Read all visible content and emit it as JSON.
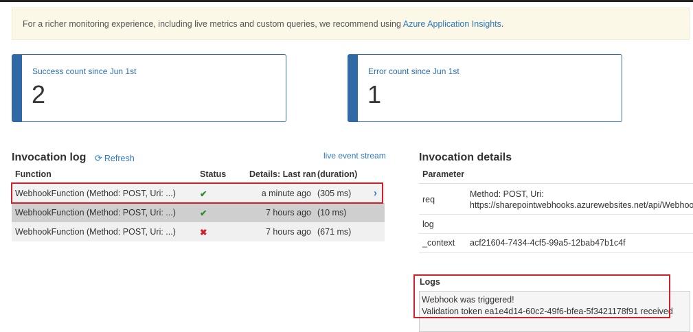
{
  "banner": {
    "text": "For a richer monitoring experience, including live metrics and custom queries, we recommend using ",
    "link": "Azure Application Insights",
    "suffix": "."
  },
  "cards": {
    "success": {
      "label": "Success count since Jun 1st",
      "value": "2"
    },
    "error": {
      "label": "Error count since Jun 1st",
      "value": "1"
    }
  },
  "invocation_log": {
    "title": "Invocation log",
    "refresh_label": "Refresh",
    "refresh_icon": "refresh-icon",
    "live_link": "live event stream",
    "columns": {
      "function": "Function",
      "status": "Status",
      "details": "Details: Last ran",
      "duration": "(duration)"
    },
    "rows": [
      {
        "function": "WebhookFunction (Method: POST, Uri: ...)",
        "status_icon": "✔",
        "when": "a minute ago",
        "duration": "(305 ms)"
      },
      {
        "function": "WebhookFunction (Method: POST, Uri: ...)",
        "status_icon": "✔",
        "when": "7 hours ago",
        "duration": "(10 ms)"
      },
      {
        "function": "WebhookFunction (Method: POST, Uri: ...)",
        "status_icon": "✖",
        "when": "7 hours ago",
        "duration": "(671 ms)"
      }
    ],
    "selected_chevron": "›"
  },
  "details": {
    "title": "Invocation details",
    "column": "Parameter",
    "params": [
      {
        "key": "req",
        "value_line1": "Method: POST, Uri:",
        "value_line2": "https://sharepointwebhooks.azurewebsites.net/api/WebhookF"
      },
      {
        "key": "log",
        "value_line1": ""
      },
      {
        "key": "_context",
        "value_line1": "acf21604-7434-4cf5-99a5-12bab47b1c4f"
      }
    ]
  },
  "logs": {
    "label": "Logs",
    "lines": [
      "Webhook was triggered!",
      "Validation token ea1e4d14-60c2-49f6-bfea-5f3421178f91 received"
    ]
  },
  "colors": {
    "accent": "#2f6aa6",
    "link": "#2a79c0",
    "success": "#2e8b2e",
    "error": "#d0202a",
    "highlight": "#d0202a"
  }
}
